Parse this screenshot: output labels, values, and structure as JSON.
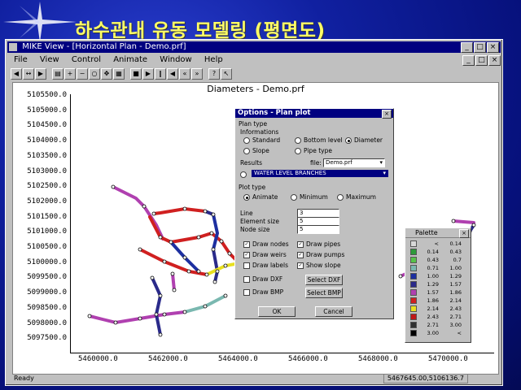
{
  "slide": {
    "title": "하수관내 유동 모델링 (평면도)"
  },
  "window": {
    "title": "MIKE View - [Horizontal Plan - Demo.prf]",
    "min_label": "_",
    "max_label": "□",
    "close_label": "×"
  },
  "menu": [
    "File",
    "View",
    "Control",
    "Animate",
    "Window",
    "Help"
  ],
  "document": {
    "title": "Diameters - Demo.prf",
    "y_ticks": [
      "5105500.0",
      "5105000.0",
      "5104500.0",
      "5104000.0",
      "5103500.0",
      "5103000.0",
      "5102500.0",
      "5102000.0",
      "5101500.0",
      "5101000.0",
      "5100500.0",
      "5100000.0",
      "5099500.0",
      "5099000.0",
      "5098500.0",
      "5098000.0",
      "5097500.0"
    ],
    "x_ticks": [
      "5460000.0",
      "5462000.0",
      "5464000.0",
      "5466000.0",
      "5468000.0",
      "5470000.0"
    ]
  },
  "status": {
    "left": "Ready",
    "coord": "5467645.00,5106136.7"
  },
  "dialog": {
    "title": "Options - Plan plot",
    "close": "×",
    "plan_type": "Plan type",
    "informations": "Informations",
    "opt_standard": "Standard",
    "opt_bottom": "Bottom level",
    "opt_diameter": "Diameter",
    "opt_slope": "Slope",
    "opt_pipe": "Pipe type",
    "results": "Results",
    "file_label": "file:",
    "file_value": "Demo.prf",
    "result_item": "WATER LEVEL BRANCHES",
    "plot_type": "Plot type",
    "opt_animate": "Animate",
    "opt_minimum": "Minimum",
    "opt_maximum": "Maximum",
    "line_label": "Line",
    "line_value": "3",
    "element_label": "Element size",
    "element_value": "5",
    "node_label": "Node size",
    "node_value": "5",
    "draw_nodes": "Draw nodes",
    "draw_weirs": "Draw weirs",
    "draw_labels": "Draw labels",
    "draw_pipes": "Draw pipes",
    "draw_pumps": "Draw pumps",
    "show_slope": "Show slope",
    "draw_dxf": "Draw DXF",
    "draw_bmp": "Draw BMP",
    "select_dxf": "Select DXF",
    "select_bmp": "Select BMP",
    "ok": "OK",
    "cancel": "Cancel"
  },
  "palette": {
    "title": "Palette",
    "close": "×",
    "rows": [
      {
        "color": "#d8d8d8",
        "from": "<",
        "to": "0.14"
      },
      {
        "color": "#2e9a3a",
        "from": "0.14",
        "to": "0.43"
      },
      {
        "color": "#57c24a",
        "from": "0.43",
        "to": "0.7"
      },
      {
        "color": "#7ab8b0",
        "from": "0.71",
        "to": "1.00"
      },
      {
        "color": "#1d2fa0",
        "from": "1.00",
        "to": "1.29"
      },
      {
        "color": "#2a2a8a",
        "from": "1.29",
        "to": "1.57"
      },
      {
        "color": "#b040b0",
        "from": "1.57",
        "to": "1.86"
      },
      {
        "color": "#d02020",
        "from": "1.86",
        "to": "2.14"
      },
      {
        "color": "#e8e020",
        "from": "2.14",
        "to": "2.43"
      },
      {
        "color": "#c01818",
        "from": "2.43",
        "to": "2.71"
      },
      {
        "color": "#303030",
        "from": "2.71",
        "to": "3.00"
      },
      {
        "color": "#000000",
        "from": "3.00",
        "to": "<"
      }
    ]
  }
}
